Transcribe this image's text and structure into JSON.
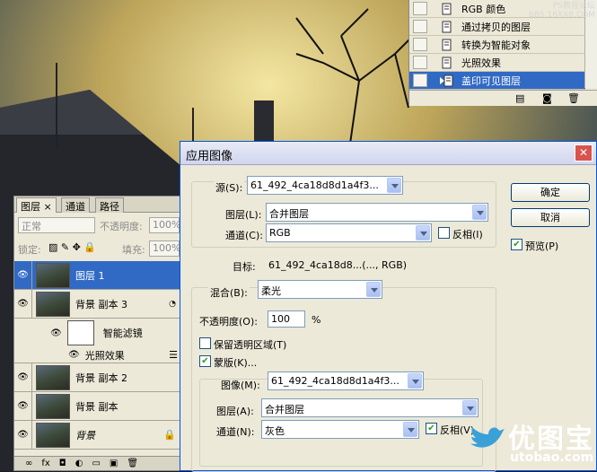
{
  "history": {
    "items": [
      {
        "label": "RGB 颜色"
      },
      {
        "label": "通过拷贝的图层"
      },
      {
        "label": "转换为智能对象"
      },
      {
        "label": "光照效果"
      },
      {
        "label": "盖印可见图层"
      }
    ],
    "selected_index": 4
  },
  "watermark": {
    "text": "PS教程论坛",
    "sub": "BBS.16XX8.COM"
  },
  "layers": {
    "tabs": [
      "图层",
      "通道",
      "路径"
    ],
    "blend": "正常",
    "opacity_label": "不透明度:",
    "opacity": "100%",
    "lock_label": "锁定:",
    "fill_label": "填充:",
    "fill": "100%",
    "rows": [
      {
        "name": "图层 1",
        "selected": true
      },
      {
        "name": "背景 副本 3"
      },
      {
        "name": "智能滤镜"
      },
      {
        "name": "光照效果"
      },
      {
        "name": "背景 副本 2"
      },
      {
        "name": "背景 副本"
      },
      {
        "name": "背景"
      }
    ]
  },
  "dialog": {
    "title": "应用图像",
    "source_label": "源(S):",
    "source_value": "61_492_4ca18d8d1a4f3...",
    "layer_label": "图层(L):",
    "layer_value": "合并图层",
    "channel_label": "通道(C):",
    "channel_value": "RGB",
    "invert_label": "反相(I)",
    "target_label": "目标:",
    "target_value": "61_492_4ca18d8...(..., RGB)",
    "blend_label": "混合(B):",
    "blend_value": "柔光",
    "opacity_label": "不透明度(O):",
    "opacity_value": "100",
    "opacity_unit": "%",
    "preserve_label": "保留透明区域(T)",
    "mask_label": "蒙版(K)...",
    "image_label": "图像(M):",
    "image_value": "61_492_4ca18d8d1a4f3...",
    "mask_layer_label": "图层(A):",
    "mask_layer_value": "合并图层",
    "mask_channel_label": "通道(N):",
    "mask_channel_value": "灰色",
    "mask_invert_label": "反相(V)",
    "ok_label": "确定",
    "cancel_label": "取消",
    "preview_label": "预览(P)",
    "invert_checked": false,
    "preserve_checked": false,
    "mask_checked": true,
    "mask_invert_checked": true,
    "preview_checked": true
  },
  "branding": {
    "name": "优图宝",
    "url": "utobao.com"
  }
}
